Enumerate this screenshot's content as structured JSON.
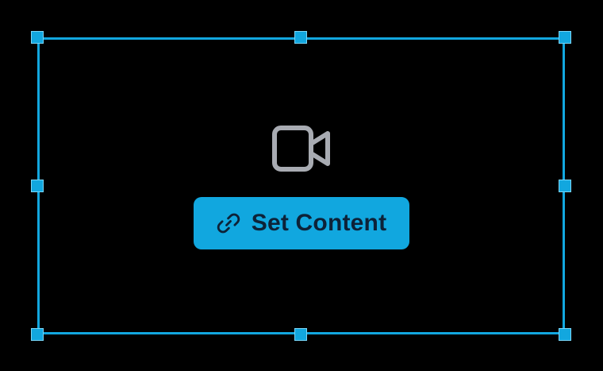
{
  "colors": {
    "background": "#000000",
    "selection_accent": "#12a7df",
    "button_background": "#11a7df",
    "button_text": "#0d2238",
    "placeholder_icon": "#a8abb2"
  },
  "placeholder": {
    "icon": "video-camera-icon"
  },
  "action_button": {
    "icon": "link-icon",
    "label": "Set Content"
  }
}
